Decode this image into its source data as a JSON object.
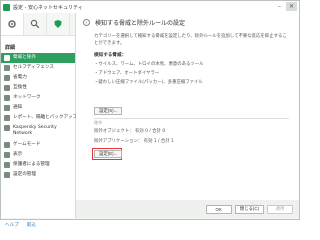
{
  "window": {
    "title": "設定 - 安心ネットセキュリティ"
  },
  "sidebar": {
    "section": "詳細",
    "items": [
      {
        "label": "脅威と除外",
        "icon": "shield-icon"
      },
      {
        "label": "セルフディフェンス",
        "icon": "self-defense-icon"
      },
      {
        "label": "省電力",
        "icon": "battery-icon"
      },
      {
        "label": "互換性",
        "icon": "compatibility-icon"
      },
      {
        "label": "ネットワーク",
        "icon": "network-icon"
      },
      {
        "label": "通知",
        "icon": "notification-icon"
      },
      {
        "label": "レポート、隔離とバックアップ",
        "icon": "report-icon"
      },
      {
        "label": "Kaspersky Security Network",
        "icon": "ksn-icon"
      },
      {
        "label": "ゲームモード",
        "icon": "game-icon"
      },
      {
        "label": "表示",
        "icon": "display-icon"
      },
      {
        "label": "保護者による管理",
        "icon": "parental-icon"
      },
      {
        "label": "設定の管理",
        "icon": "settings-manage-icon"
      }
    ],
    "footer": {
      "help": "ヘルプ",
      "support": "取込"
    }
  },
  "content": {
    "title": "検知する脅威と除外ルールの設定",
    "description": "カテゴリーを選択して検知する脅威を設定したり、除外ルールを追加して不要な反応を抑止することができます。",
    "detect_heading": "検知する脅威：",
    "bullets": [
      "・ウイルス、ワーム、トロイの木馬、悪意のあるツール",
      "・アドウェア、オートダイヤラー",
      "・疑わしい圧縮ファイル(パッカー)、多重圧縮ファイル"
    ],
    "settings_button_1": "設定(S)...",
    "exclusion_label": "除外",
    "exclusion_objects": "除外オブジェクト：  有効 0 / 合計 0",
    "exclusion_apps": "除外アプリケーション：  有効 1 / 合計 1",
    "settings_button_2": "設定(E)..."
  },
  "buttons": {
    "ok": "OK",
    "close": "閉じる(C)",
    "apply": "適用"
  },
  "colors": {
    "accent_green": "#2e9f5f",
    "highlight_red": "#e23a3a"
  }
}
